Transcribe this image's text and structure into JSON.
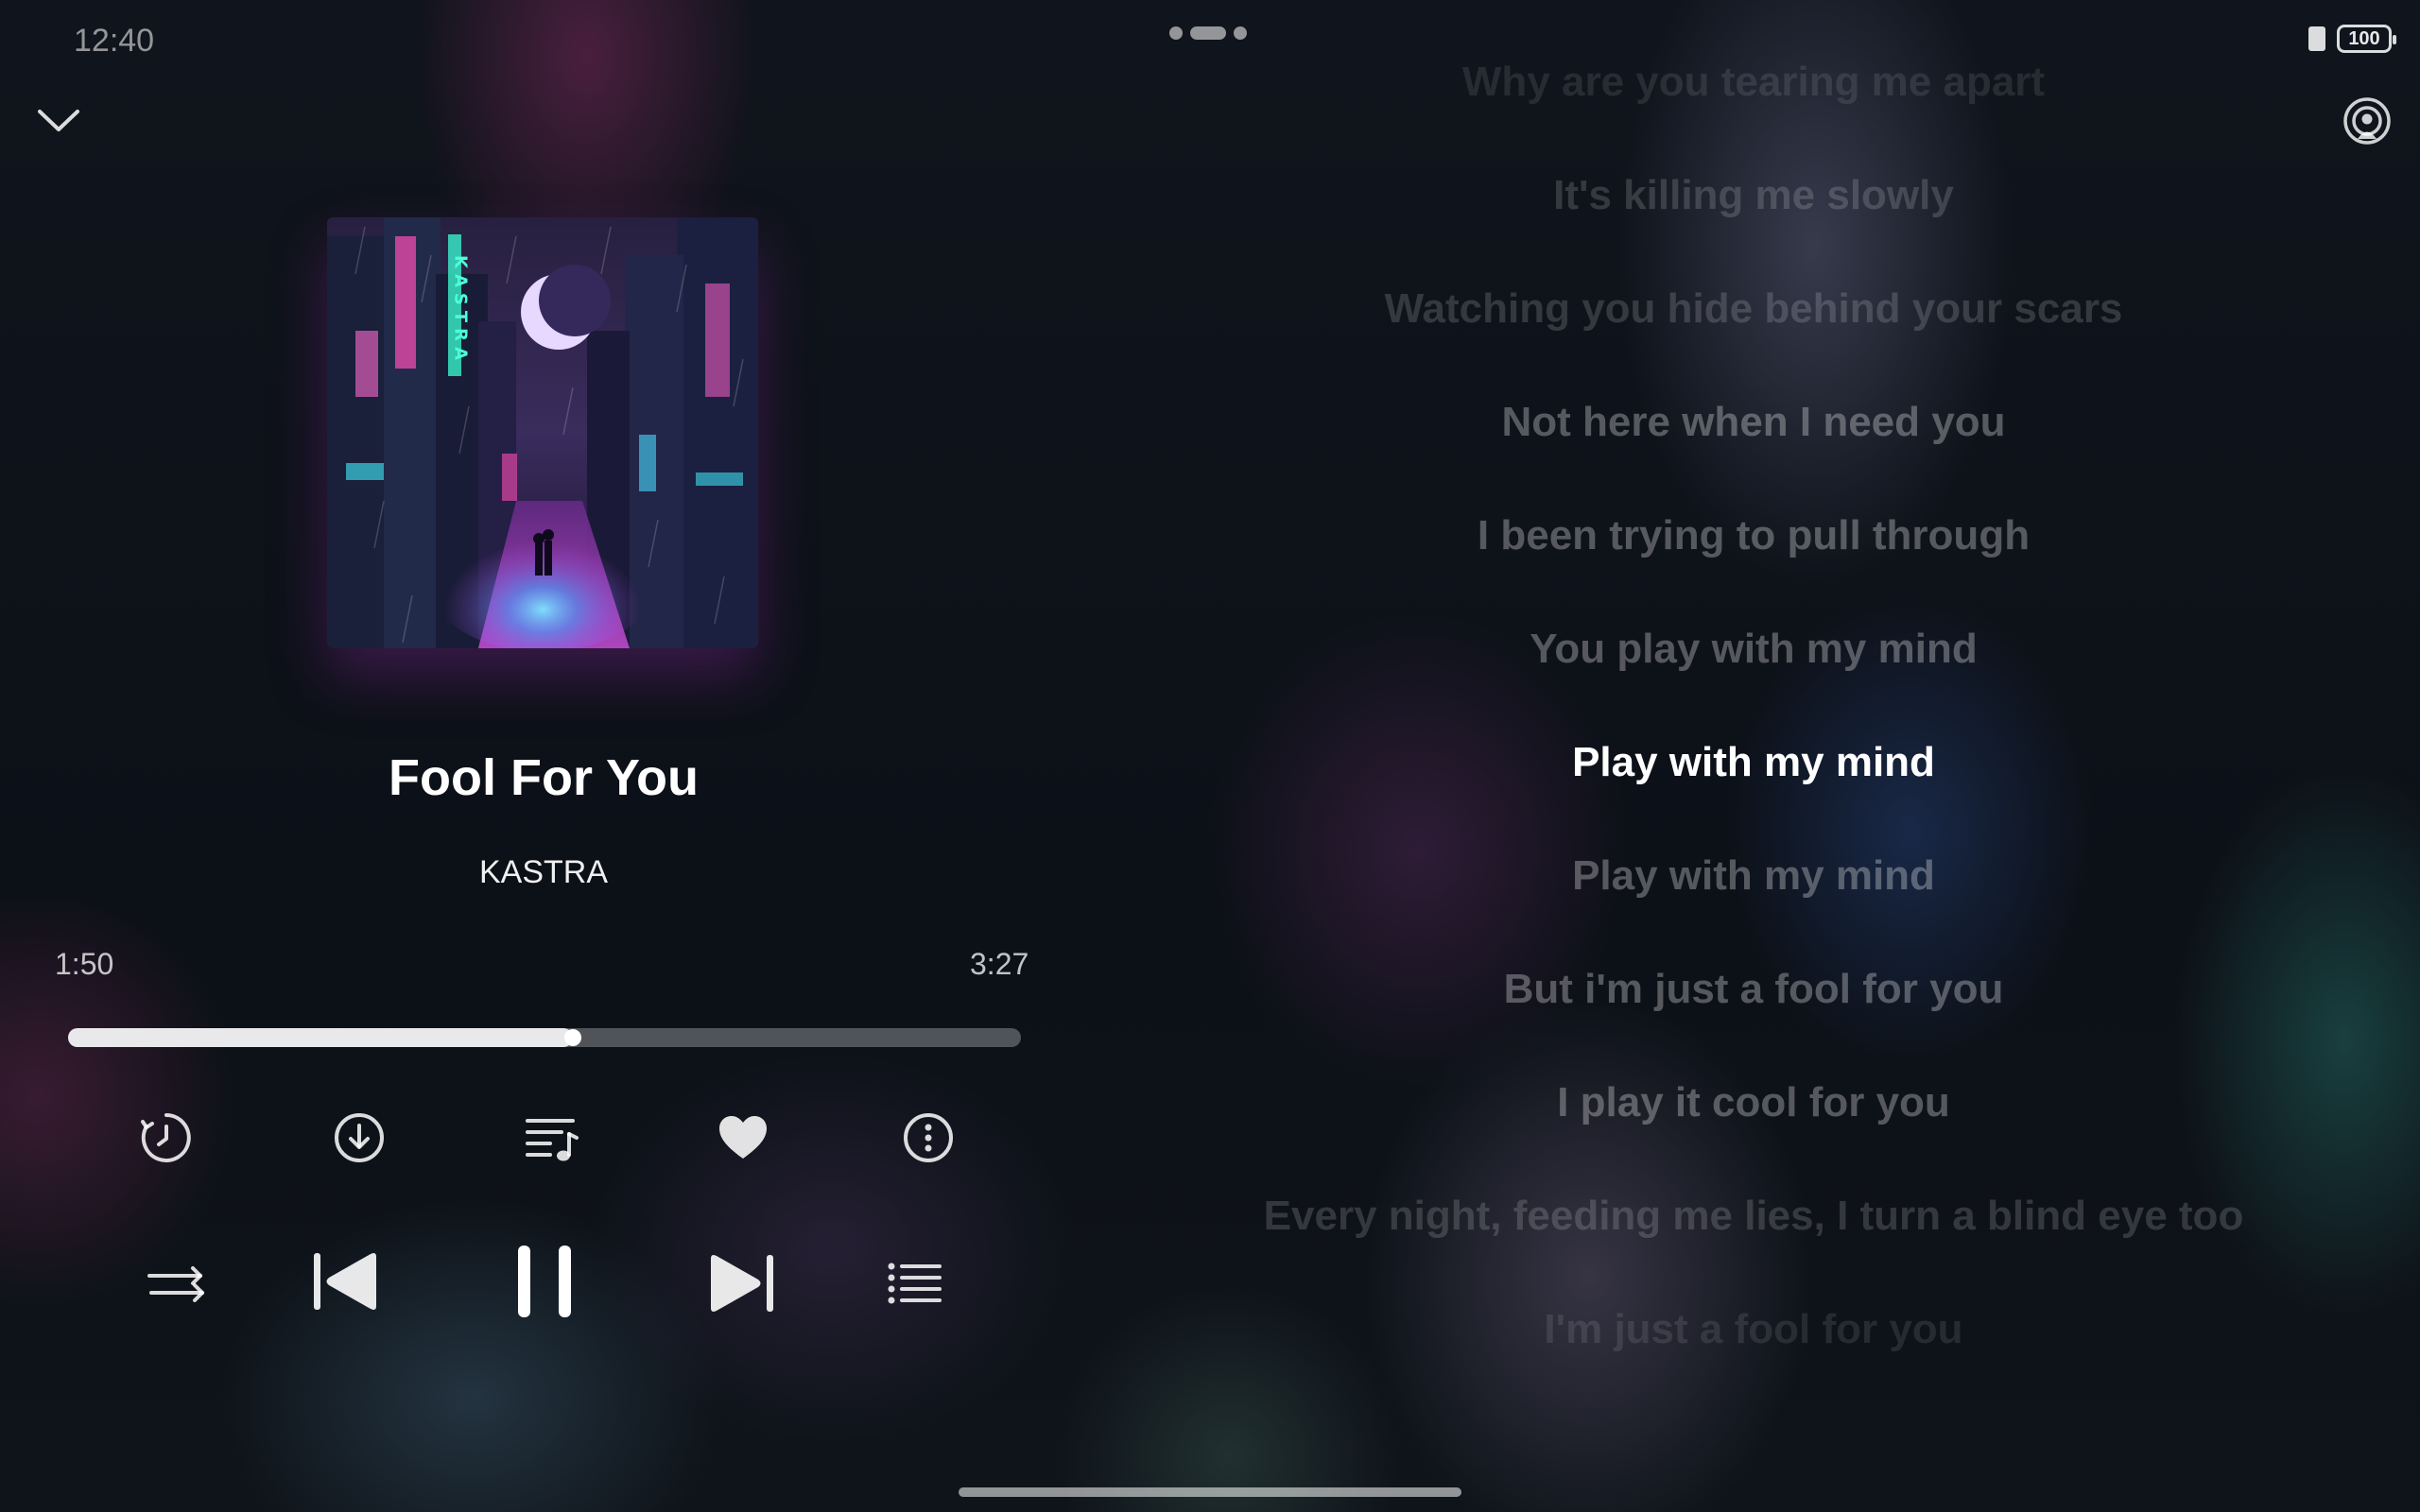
{
  "status_bar": {
    "time": "12:40",
    "battery": "100"
  },
  "track": {
    "title": "Fool For You",
    "artist": "KASTRA",
    "album_art_text": "KASTRA",
    "elapsed": "1:50",
    "duration": "3:27",
    "progress": 0.53
  },
  "controls": {
    "row1": [
      "sleep-timer-icon",
      "download-icon",
      "add-to-playlist-icon",
      "favorite-heart-icon",
      "more-options-icon"
    ],
    "row2": [
      "repeat-order-icon",
      "previous-track-icon",
      "pause-icon",
      "next-track-icon",
      "queue-list-icon"
    ]
  },
  "lyrics": {
    "lines": [
      "Why are you tearing me apart",
      "It's killing me slowly",
      "Watching you hide behind your scars",
      "Not here when I need you",
      "I been trying to pull through",
      "You play with my mind",
      "Play with my mind",
      "Play with my mind",
      "But i'm just a fool for you",
      "I play it cool for you",
      "Every night, feeding me lies, I turn a blind eye too",
      "I'm just a fool for you"
    ],
    "active_index": 6
  },
  "colors": {
    "active_lyric": "#ffffff",
    "inactive_lyric": "rgba(255,255,255,0.30)",
    "progress_fill": "#e9e9ec"
  }
}
